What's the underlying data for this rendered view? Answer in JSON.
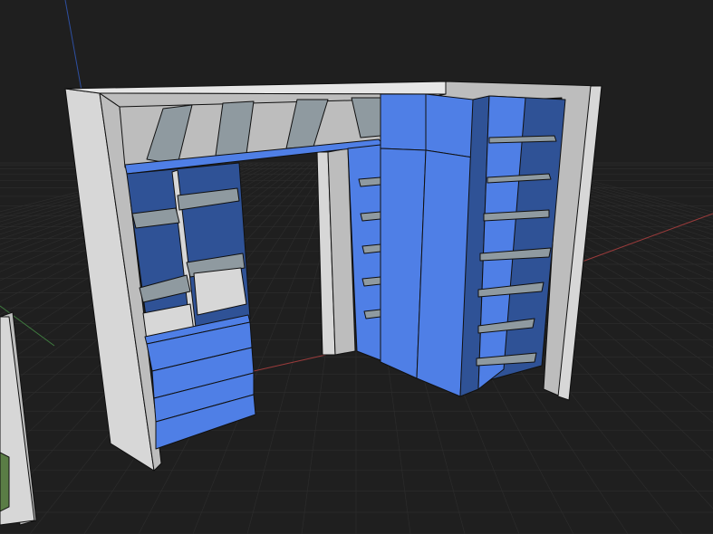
{
  "viewport": {
    "background_color": "#1f1f1f",
    "grid_color": "#2c2c2c",
    "axis_x_color": "#9a3b3b",
    "axis_y_color": "#3f7a3f",
    "axis_z_color": "#2e4fa0"
  },
  "model": {
    "frame_color": "#d7d7d7",
    "frame_side_color": "#bdbdbd",
    "frame_top_color": "#e6e6e6",
    "selected_face_color": "#4f7fe6",
    "selected_dark_color": "#2f5296",
    "shelf_color": "#8f9aa0",
    "edge_color": "#101010"
  }
}
